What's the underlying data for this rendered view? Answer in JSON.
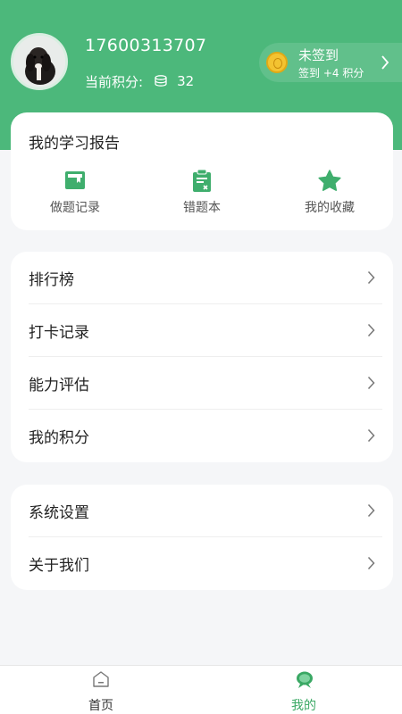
{
  "profile": {
    "phone": "17600313707",
    "points_label": "当前积分:",
    "points_value": "32"
  },
  "signin": {
    "status": "未签到",
    "reward": "签到 +4 积分"
  },
  "report": {
    "title": "我的学习报告",
    "shortcuts": [
      {
        "label": "做题记录",
        "icon": "record-icon"
      },
      {
        "label": "错题本",
        "icon": "wrong-book-icon"
      },
      {
        "label": "我的收藏",
        "icon": "star-icon"
      }
    ]
  },
  "menu_group_1": [
    {
      "label": "排行榜"
    },
    {
      "label": "打卡记录"
    },
    {
      "label": "能力评估"
    },
    {
      "label": "我的积分"
    }
  ],
  "menu_group_2": [
    {
      "label": "系统设置"
    },
    {
      "label": "关于我们"
    }
  ],
  "tabbar": {
    "tabs": [
      {
        "label": "首页",
        "icon": "home-icon",
        "active": false
      },
      {
        "label": "我的",
        "icon": "profile-chat-icon",
        "active": true
      }
    ]
  },
  "colors": {
    "brand": "#4cb87b",
    "active_tab": "#3aa864",
    "background": "#f5f6f8"
  }
}
